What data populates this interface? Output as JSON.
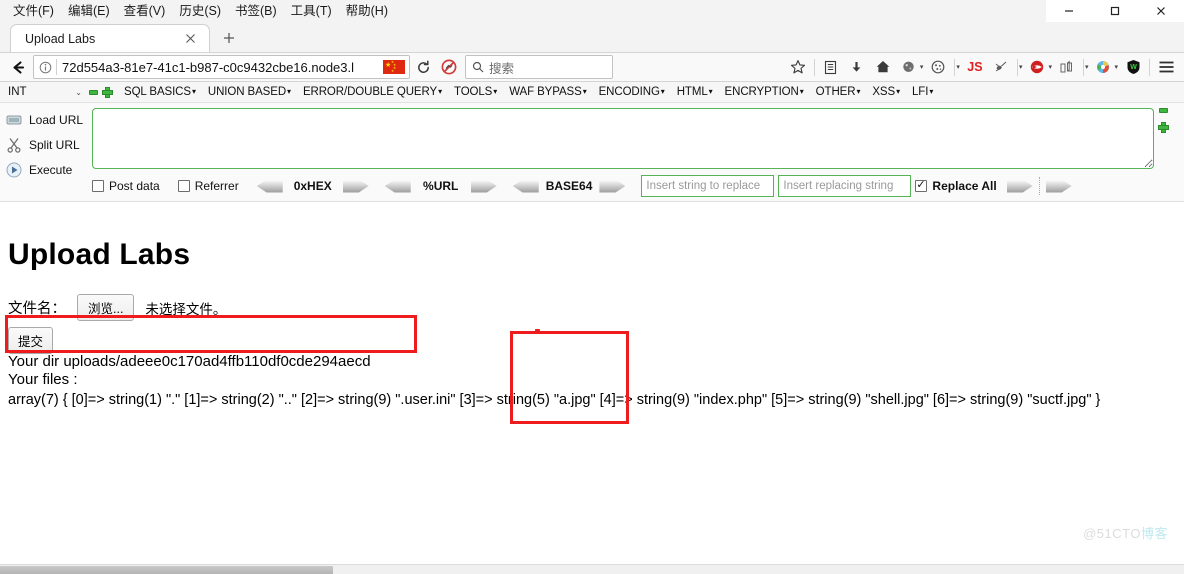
{
  "window": {
    "menus": [
      {
        "label": "文件(F)",
        "name": "menu-file"
      },
      {
        "label": "编辑(E)",
        "name": "menu-edit"
      },
      {
        "label": "查看(V)",
        "name": "menu-view"
      },
      {
        "label": "历史(S)",
        "name": "menu-history"
      },
      {
        "label": "书签(B)",
        "name": "menu-bookmarks"
      },
      {
        "label": "工具(T)",
        "name": "menu-tools"
      },
      {
        "label": "帮助(H)",
        "name": "menu-help"
      }
    ],
    "controls": {
      "minimize": "–",
      "maximize": "□",
      "close": "✕"
    }
  },
  "tabs": {
    "items": [
      {
        "title": "Upload Labs",
        "close": "✕"
      }
    ],
    "new_tab": "+"
  },
  "navbar": {
    "back": "←",
    "info_icon": "info-icon",
    "url": "72d554a3-81e7-41c1-b987-c0c9432cbe16.node3.l",
    "reload": "⟳",
    "blocked": "blocked-icon",
    "search_placeholder": "搜索",
    "icons": [
      {
        "name": "bookmark-star-icon"
      },
      {
        "name": "library-icon"
      },
      {
        "name": "downloads-icon"
      },
      {
        "name": "home-icon"
      },
      {
        "name": "firebug-icon"
      },
      {
        "name": "cookie-icon"
      },
      {
        "name": "javascript-toggle-icon",
        "label": "JS"
      },
      {
        "name": "tamper-data-icon"
      },
      {
        "name": "hackbar-icon"
      },
      {
        "name": "proxy-switch-icon"
      },
      {
        "name": "user-agent-icon"
      },
      {
        "name": "adblock-shield-icon"
      },
      {
        "name": "hamburger-menu-icon"
      }
    ]
  },
  "hackbar": {
    "type_select": {
      "value": "INT",
      "chevron": "⌄"
    },
    "minus": "−",
    "plus": "+",
    "menus": [
      "SQL BASICS",
      "UNION BASED",
      "ERROR/DOUBLE QUERY",
      "TOOLS",
      "WAF BYPASS",
      "ENCODING",
      "HTML",
      "ENCRYPTION",
      "OTHER",
      "XSS",
      "LFI"
    ],
    "actions": [
      {
        "label": "Load URL",
        "icon": "load-url-icon"
      },
      {
        "label": "Split URL",
        "icon": "split-url-icon"
      },
      {
        "label": "Execute",
        "icon": "execute-icon"
      }
    ],
    "textarea_value": "",
    "checkboxes": [
      {
        "label": "Post data",
        "checked": false
      },
      {
        "label": "Referrer",
        "checked": false
      }
    ],
    "codecs": [
      "0xHEX",
      "%URL",
      "BASE64"
    ],
    "replace_search_placeholder": "Insert string to replace",
    "replace_with_placeholder": "Insert replacing string",
    "replace_all": {
      "label": "Replace All",
      "checked": true
    }
  },
  "page": {
    "title": "Upload Labs",
    "file_label": "文件名：",
    "browse_button": "浏览...",
    "no_file_text": "未选择文件。",
    "submit_button": "提交",
    "dir_line": "Your dir uploads/adeee0c170ad4ffb110df0cde294aecd",
    "files_label": "Your files :",
    "array_line": "array(7) { [0]=> string(1) \".\" [1]=> string(2) \"..\" [2]=> string(9) \".user.ini\" [3]=> string(5) \"a.jpg\" [4]=> string(9) \"index.php\" [5]=> string(9) \"shell.jpg\" [6]=> string(9) \"suctf.jpg\" }",
    "annotations": [
      {
        "name": "highlight-dir-box",
        "color": "#ee1c1c"
      },
      {
        "name": "highlight-ajpg-box",
        "color": "#ee1c1c"
      }
    ]
  },
  "watermark": {
    "prefix": "@51CTO",
    "suffix": "博客"
  }
}
